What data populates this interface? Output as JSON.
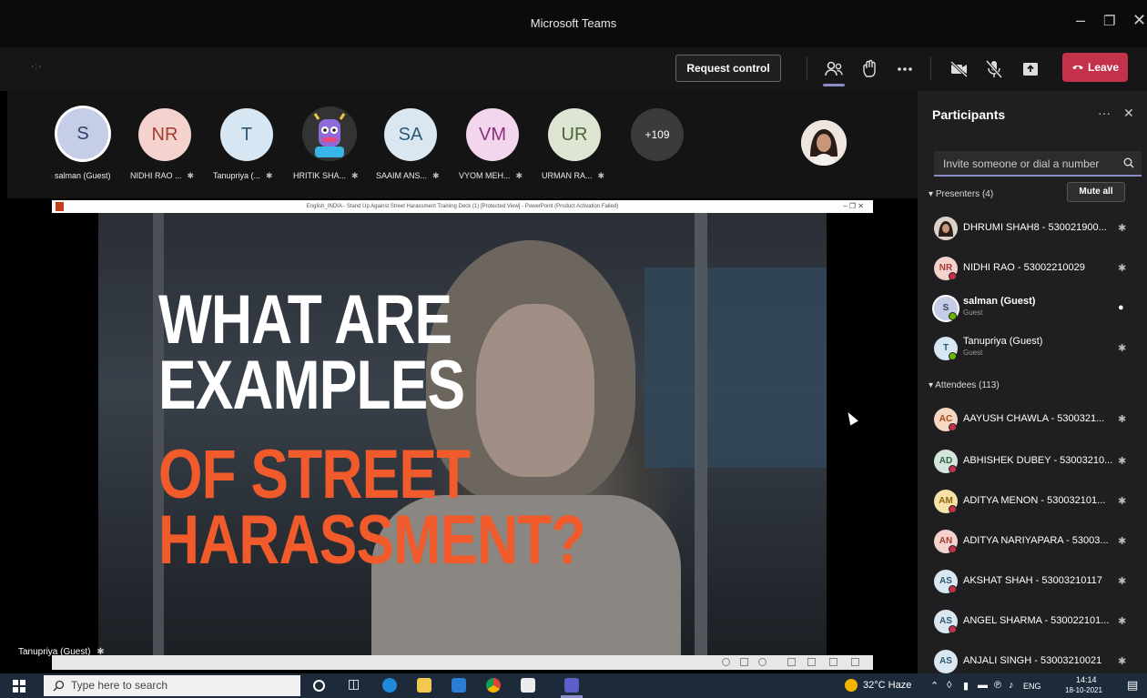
{
  "window": {
    "title": "Microsoft Teams"
  },
  "toolbar": {
    "timer": "-:-",
    "request_control": "Request control",
    "leave": "Leave"
  },
  "strip": {
    "participants": [
      {
        "initials": "S",
        "name": "salman (Guest)",
        "bg": "#c6cde7",
        "fg": "#3a3f69",
        "ring": true
      },
      {
        "initials": "NR",
        "name": "NIDHI RAO ...",
        "bg": "#f4d3cf",
        "fg": "#a53c2f"
      },
      {
        "initials": "T",
        "name": "Tanupriya (...",
        "bg": "#d6e6f2",
        "fg": "#2b5674"
      },
      {
        "initials": "",
        "name": "HRITIK SHA...",
        "bg": "#2a2a2a",
        "fg": "#fff",
        "image": true
      },
      {
        "initials": "SA",
        "name": "SAAIM ANS...",
        "bg": "#dbe7f0",
        "fg": "#2c5a76"
      },
      {
        "initials": "VM",
        "name": "VYOM MEH...",
        "bg": "#f3d6ee",
        "fg": "#8d2f7c"
      },
      {
        "initials": "UR",
        "name": "URMAN RA...",
        "bg": "#dde6d3",
        "fg": "#4e6339"
      }
    ],
    "more_count": "+109"
  },
  "presentation": {
    "ppt_title": "English_INDIA - Stand Up Against Street Harassment Training Deck (1) [Protected View] - PowerPoint (Product Activation Failed)",
    "line1": "WHAT ARE",
    "line2": "EXAMPLES",
    "line3": "OF STREET",
    "line4": "HARASSMENT?",
    "presenter_label": "Tanupriya (Guest)"
  },
  "panel": {
    "title": "Participants",
    "invite_placeholder": "Invite someone or dial a number",
    "presenters_header": "Presenters (4)",
    "mute_all": "Mute all",
    "attendees_header": "Attendees (113)",
    "presenters": [
      {
        "initials": "",
        "name": "DHRUMI SHAH8 - 530021900...",
        "sub": "",
        "bg": "#8a6f62",
        "fg": "#fff",
        "mic": "off"
      },
      {
        "initials": "NR",
        "name": "NIDHI RAO - 53002210029",
        "sub": "",
        "bg": "#f4d3cf",
        "fg": "#a53c2f",
        "mic": "off"
      },
      {
        "initials": "S",
        "name": "salman (Guest)",
        "sub": "Guest",
        "bg": "#c6cde7",
        "fg": "#3a3f69",
        "mic": "on"
      },
      {
        "initials": "T",
        "name": "Tanupriya (Guest)",
        "sub": "Guest",
        "bg": "#d6e6f2",
        "fg": "#2b5674",
        "mic": "off"
      }
    ],
    "attendees": [
      {
        "initials": "AC",
        "name": "AAYUSH CHAWLA - 5300321...",
        "bg": "#f6d7c2",
        "fg": "#a34a17"
      },
      {
        "initials": "AD",
        "name": "ABHISHEK DUBEY - 53003210...",
        "bg": "#d4e5dc",
        "fg": "#2f6447"
      },
      {
        "initials": "AM",
        "name": "ADITYA MENON - 530032101...",
        "bg": "#f7e3a9",
        "fg": "#8a6a0d"
      },
      {
        "initials": "AN",
        "name": "ADITYA NARIYAPARA - 53003...",
        "bg": "#f4d3cf",
        "fg": "#a53c2f"
      },
      {
        "initials": "AS",
        "name": "AKSHAT SHAH - 53003210117",
        "bg": "#dbe7f0",
        "fg": "#2c5a76"
      },
      {
        "initials": "AS",
        "name": "ANGEL SHARMA - 530022101...",
        "bg": "#dbe7f0",
        "fg": "#2c5a76"
      },
      {
        "initials": "AS",
        "name": "ANJALI SINGH - 53003210021",
        "bg": "#dbe7f0",
        "fg": "#2c5a76"
      }
    ]
  },
  "taskbar": {
    "search_placeholder": "Type here to search",
    "weather": "32°C Haze",
    "lang": "ENG",
    "time": "14:14",
    "date": "18-10-2021"
  }
}
